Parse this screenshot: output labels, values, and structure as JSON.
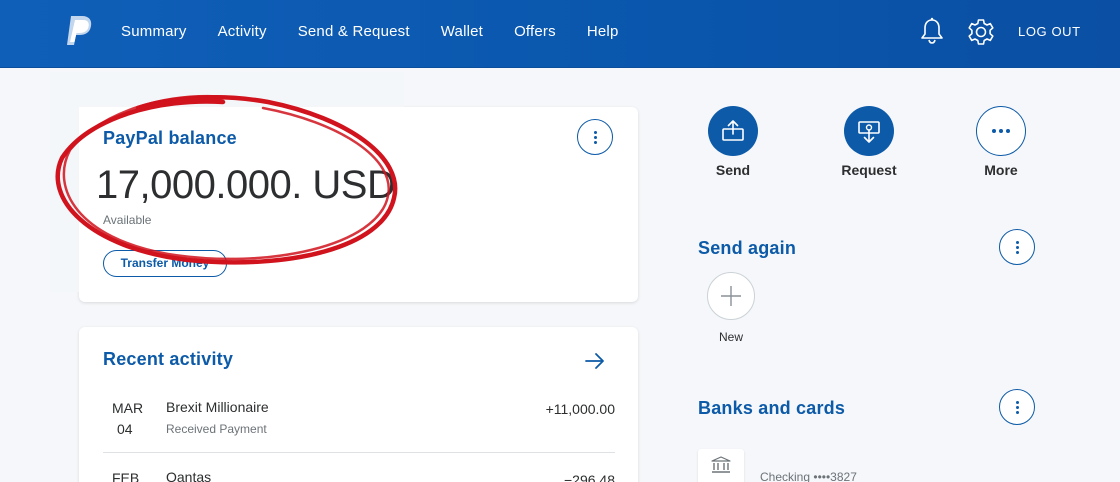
{
  "header": {
    "nav": [
      "Summary",
      "Activity",
      "Send & Request",
      "Wallet",
      "Offers",
      "Help"
    ],
    "logout_label": "LOG OUT",
    "brand_color": "#0c5aa8"
  },
  "balance": {
    "title": "PayPal balance",
    "amount": "17,000.000. USD",
    "available_label": "Available",
    "transfer_label": "Transfer Money"
  },
  "activity": {
    "title": "Recent activity",
    "rows": [
      {
        "month": "MAR",
        "day": "04",
        "name": "Brexit Millionaire",
        "subtitle": "Received Payment",
        "amount": "+11,000.00"
      },
      {
        "month": "FEB",
        "day": "",
        "name": "Qantas",
        "subtitle": "",
        "amount": "−296.48"
      }
    ]
  },
  "actions": [
    {
      "label": "Send",
      "icon": "send-money-icon"
    },
    {
      "label": "Request",
      "icon": "request-money-icon"
    },
    {
      "label": "More",
      "icon": "more-horizontal-icon"
    }
  ],
  "send_again": {
    "title": "Send again",
    "new_label": "New"
  },
  "banks": {
    "title": "Banks and cards",
    "account_label": "Checking ••••3827"
  },
  "annotation_color": "#d0131d"
}
